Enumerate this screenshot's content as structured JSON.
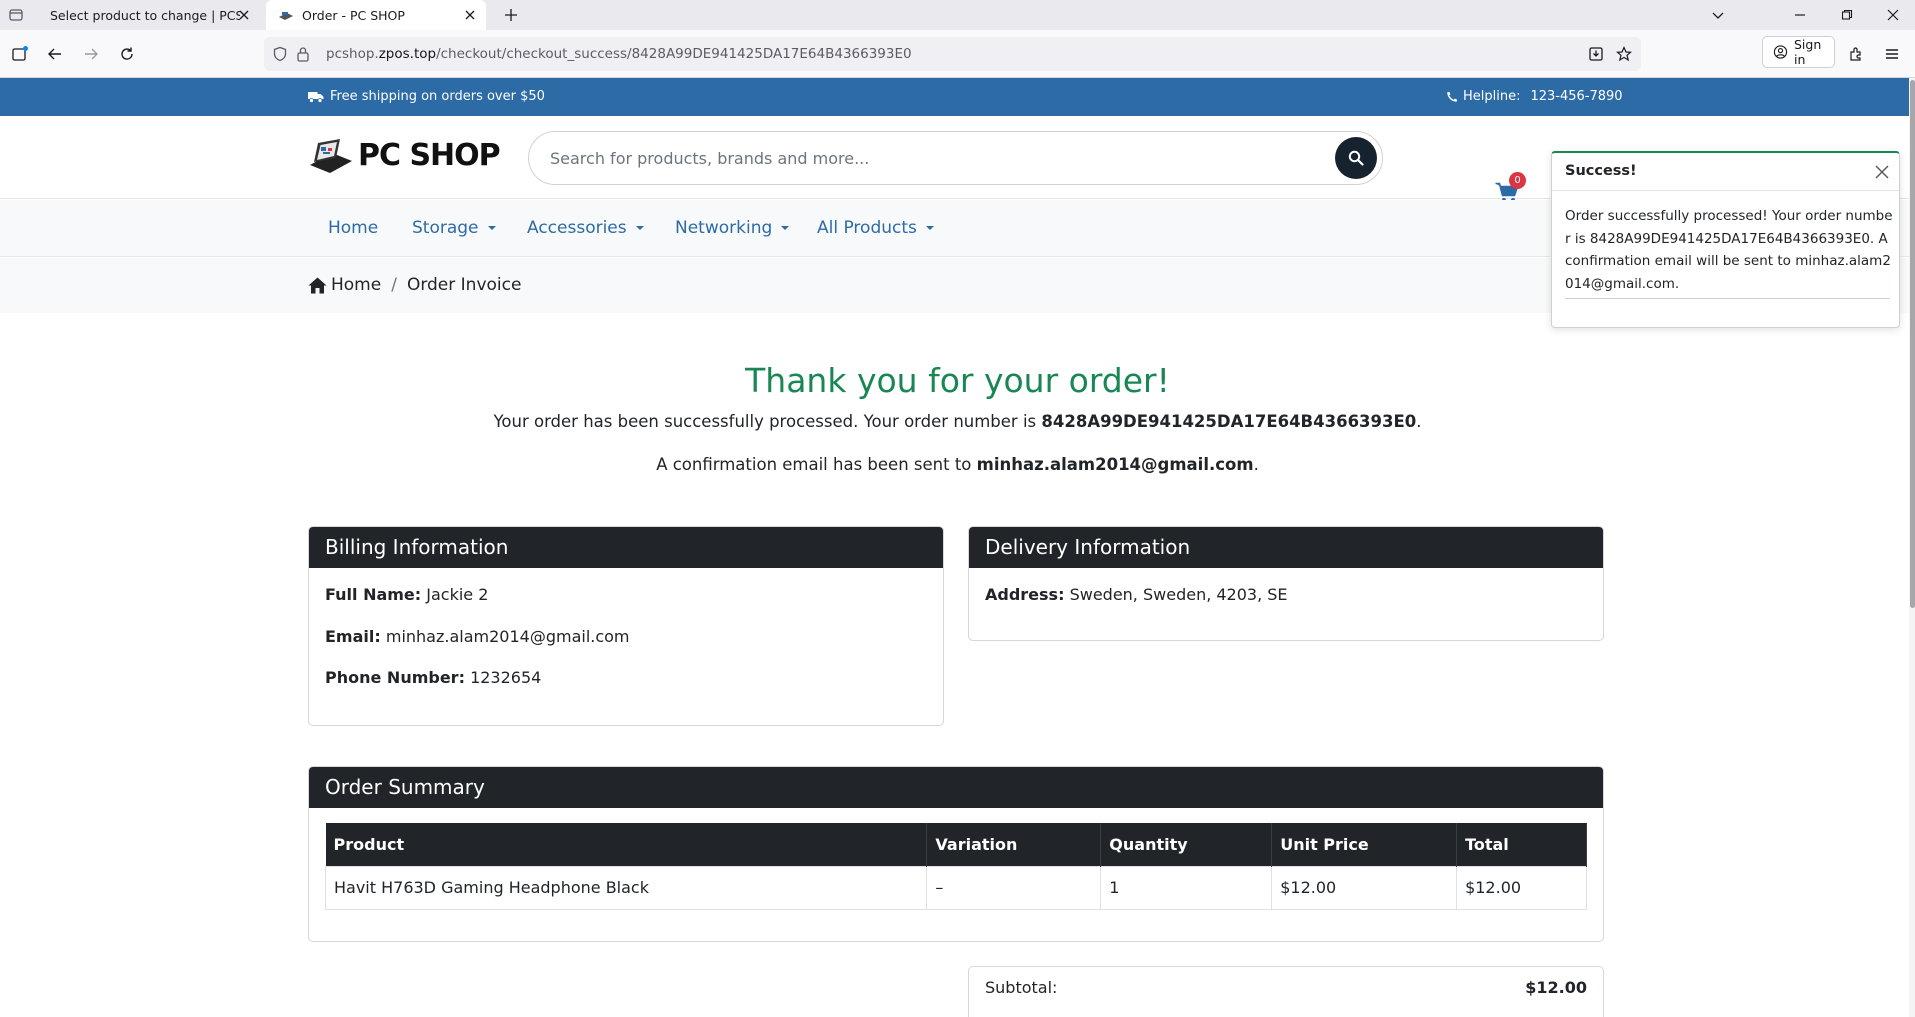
{
  "browser": {
    "tabs": [
      {
        "title": "Select product to change | PCSHOP"
      },
      {
        "title": "Order - PC SHOP"
      }
    ],
    "url_domain": "pcshop.",
    "url_host": "zpos.top",
    "url_path": "/checkout/checkout_success/8428A99DE941425DA17E64B4366393E0",
    "sign_in": "Sign in"
  },
  "topbar": {
    "shipping": "Free shipping on orders over $50",
    "helpline_label": "Helpline:",
    "helpline_number": "123-456-7890"
  },
  "header": {
    "logo_text": "PC SHOP",
    "search_placeholder": "Search for products, brands and more...",
    "cart_count": "0"
  },
  "menu": {
    "items": [
      {
        "label": "Home"
      },
      {
        "label": "Storage"
      },
      {
        "label": "Accessories"
      },
      {
        "label": "Networking"
      },
      {
        "label": "All Products"
      }
    ]
  },
  "breadcrumb": {
    "home": "Home",
    "separator": "/",
    "current": "Order Invoice"
  },
  "order": {
    "thanks": "Thank you for your order!",
    "processed_text": "Your order has been successfully processed. Your order number is ",
    "order_number": "8428A99DE941425DA17E64B4366393E0",
    "period": ".",
    "confirm_text": "A confirmation email has been sent to ",
    "email": "minhaz.alam2014@gmail.com"
  },
  "billing": {
    "title": "Billing Information",
    "full_name_label": "Full Name:",
    "full_name": "Jackie 2",
    "email_label": "Email:",
    "email": "minhaz.alam2014@gmail.com",
    "phone_label": "Phone Number:",
    "phone": "1232654"
  },
  "delivery": {
    "title": "Delivery Information",
    "address_label": "Address:",
    "address": "Sweden, Sweden, 4203, SE"
  },
  "summary": {
    "title": "Order Summary",
    "columns": [
      "Product",
      "Variation",
      "Quantity",
      "Unit Price",
      "Total"
    ],
    "rows": [
      {
        "product": "Havit H763D Gaming Headphone Black",
        "variation": "–",
        "quantity": "1",
        "unit_price": "$12.00",
        "total": "$12.00"
      }
    ],
    "subtotal_label": "Subtotal:",
    "subtotal": "$12.00"
  },
  "toast": {
    "title": "Success!",
    "message": "Order successfully processed! Your order number is 8428A99DE941425DA17E64B4366393E0. A confirmation email will be sent to minhaz.alam2014@gmail.com."
  },
  "colors": {
    "brand_blue": "#2d6ba6",
    "dark": "#212529",
    "success_green": "#198754",
    "badge_red": "#dc3545"
  }
}
